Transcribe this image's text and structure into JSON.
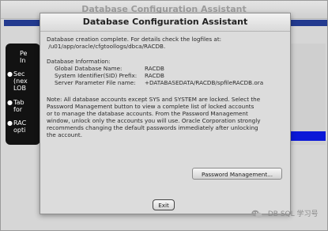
{
  "background_window": {
    "title": "Database Configuration Assistant",
    "left_panel_lines": [
      "Pe",
      "In",
      "Sec",
      "(nex",
      "LOB",
      "Tab",
      "for",
      "RAC",
      "opti"
    ]
  },
  "dialog": {
    "title": "Database Configuration Assistant",
    "message": "Database creation complete. For details check the logfiles at:\n /u01/app/oracle/cfgtoollogs/dbca/RACDB.",
    "info_heading": "Database Information:",
    "info_rows": [
      {
        "key": "Global Database Name:",
        "value": "RACDB"
      },
      {
        "key": "System Identifier(SID) Prefix:",
        "value": "RACDB"
      },
      {
        "key": "Server Parameter File name:",
        "value": "+DATABASEDATA/RACDB/spfileRACDB.ora"
      }
    ],
    "note": "Note: All database accounts except SYS and SYSTEM are locked. Select the\nPassword Management button to view a complete list of locked accounts\nor to manage the database accounts. From the Password Management\nwindow, unlock only the accounts you will use. Oracle Corporation strongly\nrecommends changing the default passwords immediately after unlocking\nthe account.",
    "password_button": "Password Management...",
    "exit_button": "Exit"
  },
  "watermark": {
    "text": "DB SQL 学习号",
    "icon": "wechat-icon"
  },
  "colors": {
    "blue_strip": "#233a8f",
    "progress_fill": "#0a18d8",
    "dark_panel": "#121212"
  }
}
